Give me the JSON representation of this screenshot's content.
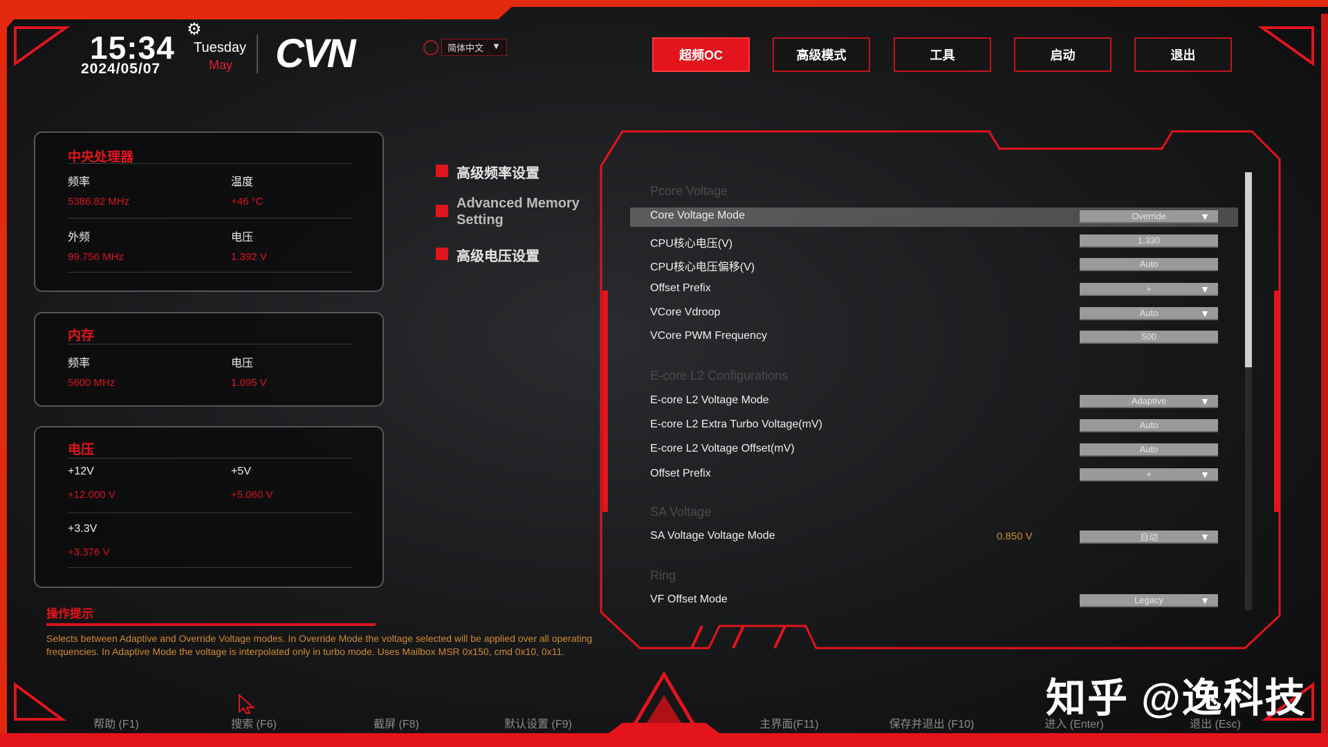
{
  "colors": {
    "accent": "#e3141c",
    "hint": "#d08a30",
    "value_box": "#9a9a9a"
  },
  "header": {
    "time": "15:34",
    "date": "2024/05/07",
    "weekday": "Tuesday",
    "month": "May",
    "logo": "CVN",
    "language": "简体中文",
    "gear_icon": "gear-icon",
    "globe_icon": "globe-icon"
  },
  "tabs": [
    {
      "label": "超频OC",
      "active": true
    },
    {
      "label": "高级模式"
    },
    {
      "label": "工具"
    },
    {
      "label": "启动"
    },
    {
      "label": "退出"
    }
  ],
  "cpu": {
    "title": "中央处理器",
    "freq_label": "频率",
    "freq": "5386.82 MHz",
    "temp_label": "温度",
    "temp": "+46 °C",
    "bclk_label": "外频",
    "bclk": "99.756 MHz",
    "volt_label": "电压",
    "volt": "1.392 V"
  },
  "memory": {
    "title": "内存",
    "freq_label": "频率",
    "freq": "5600 MHz",
    "volt_label": "电压",
    "volt": "1.095 V"
  },
  "voltage": {
    "title": "电压",
    "v12_label": "+12V",
    "v12": "+12.000 V",
    "v5_label": "+5V",
    "v5": "+5.060 V",
    "v33_label": "+3.3V",
    "v33": "+3.376 V"
  },
  "submenu": [
    "高级频率设置",
    "Advanced Memory Setting",
    "高级电压设置"
  ],
  "settings": {
    "sections": [
      "Pcore Voltage",
      "E-core L2 Configurations",
      "SA Voltage",
      "Ring"
    ],
    "rows": [
      {
        "label": "Core Voltage Mode",
        "value": "Override",
        "dropdown": true,
        "selected": true
      },
      {
        "label": "CPU核心电压(V)",
        "value": "1.330"
      },
      {
        "label": "CPU核心电压偏移(V)",
        "value": "Auto"
      },
      {
        "label": "Offset Prefix",
        "value": "+",
        "dropdown": true
      },
      {
        "label": "VCore Vdroop",
        "value": "Auto",
        "dropdown": true
      },
      {
        "label": "VCore PWM Frequency",
        "value": "500"
      },
      {
        "label": "E-core L2 Voltage Mode",
        "value": "Adaptive",
        "dropdown": true
      },
      {
        "label": "E-core L2 Extra Turbo Voltage(mV)",
        "value": "Auto"
      },
      {
        "label": "E-core L2 Voltage Offset(mV)",
        "value": "Auto"
      },
      {
        "label": "Offset Prefix",
        "value": "+",
        "dropdown": true
      },
      {
        "label": "SA Voltage Voltage Mode",
        "value": "自动",
        "dropdown": true,
        "reading": "0.850 V"
      },
      {
        "label": "VF Offset Mode",
        "value": "Legacy",
        "dropdown": true
      }
    ],
    "scroll_position": 0.0,
    "arrow": "▼"
  },
  "hint": {
    "title": "操作提示",
    "text": "Selects between Adaptive and Override Voltage modes. In Override Mode the voltage selected will be applied over all operating frequencies. In Adaptive Mode the voltage is interpolated only in turbo mode. Uses Mailbox MSR 0x150, cmd 0x10, 0x11."
  },
  "footer": [
    "帮助 (F1)",
    "搜索 (F6)",
    "截屏 (F8)",
    "默认设置 (F9)",
    "主界面(F11)",
    "保存并退出 (F10)",
    "进入 (Enter)",
    "退出 (Esc)"
  ],
  "watermark": "知乎 @逸科技"
}
